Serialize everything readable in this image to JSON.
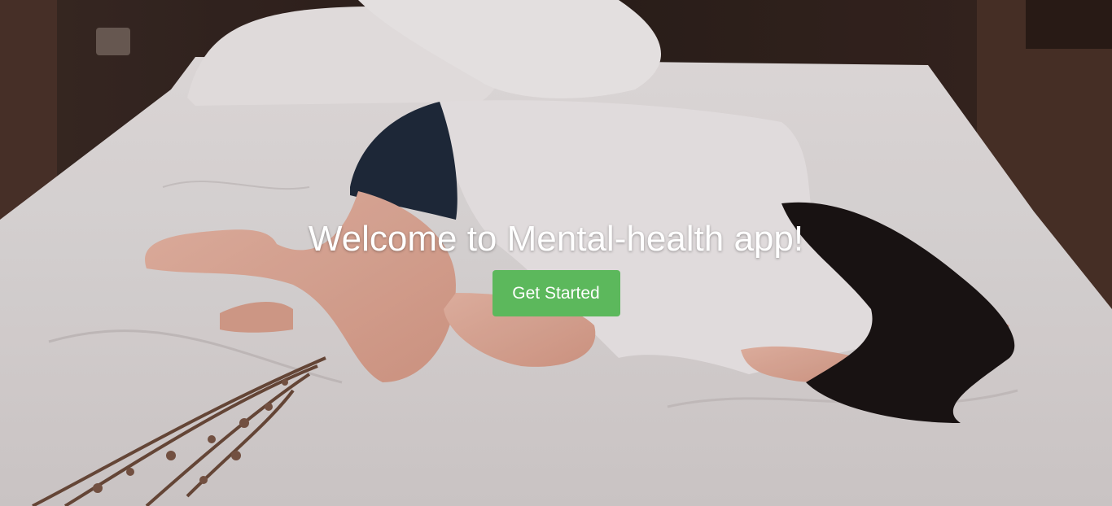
{
  "hero": {
    "title": "Welcome to Mental-health app!",
    "cta_label": "Get Started",
    "background_description": "woman lying on bed"
  },
  "colors": {
    "cta_background": "#5cb85c",
    "title_text": "#ffffff"
  }
}
